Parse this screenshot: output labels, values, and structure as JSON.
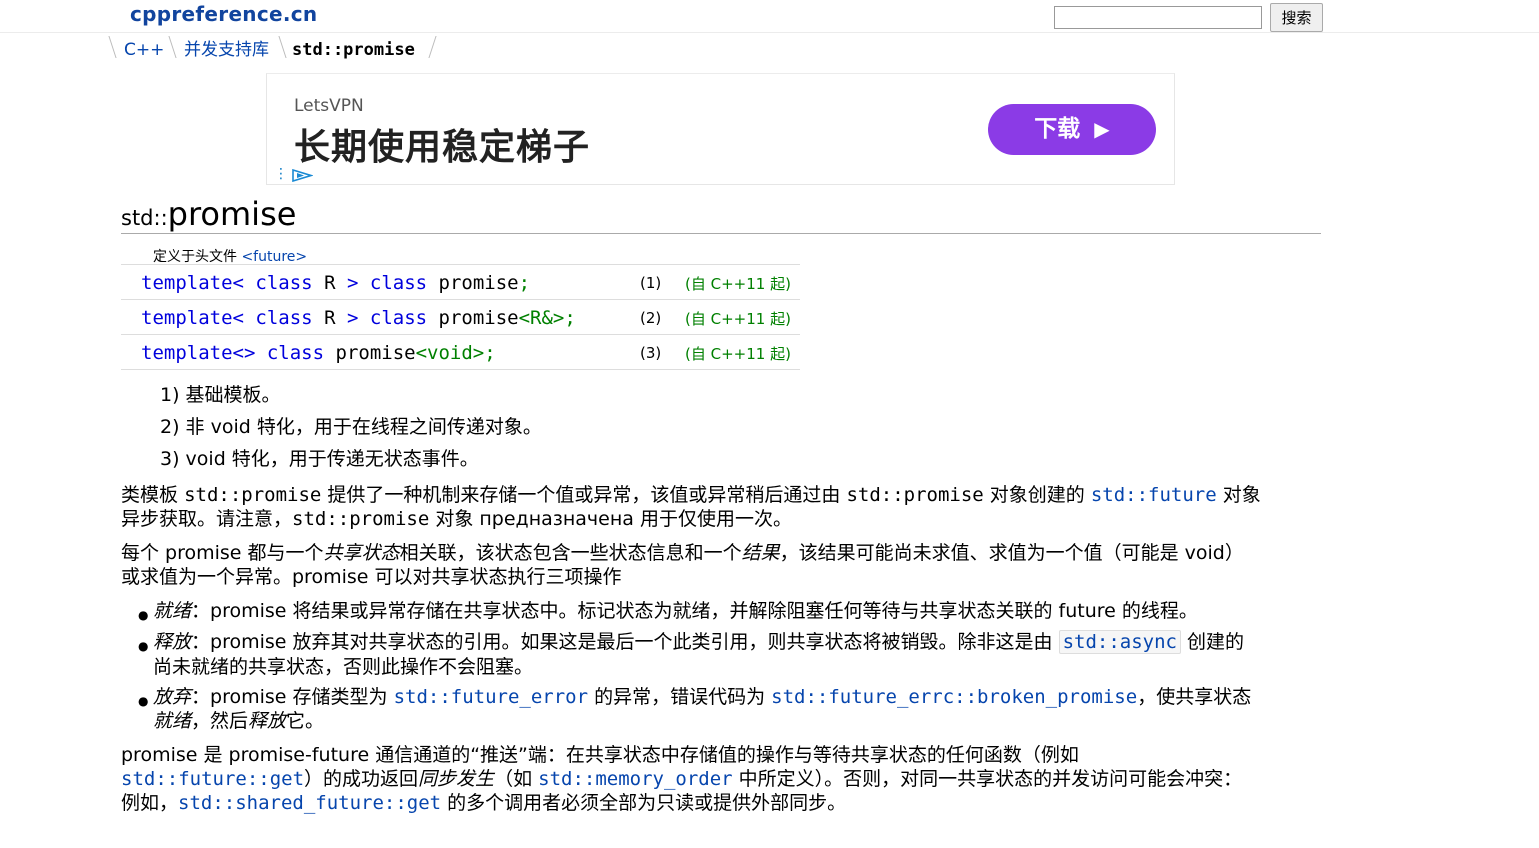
{
  "header": {
    "site_name": "cppreference.cn",
    "search_button": "搜索",
    "search_value": ""
  },
  "breadcrumb": [
    "C++",
    "并发支持库",
    "std::promise"
  ],
  "ad": {
    "brand": "LetsVPN",
    "headline": "长期使用稳定梯子",
    "button_label": "下载",
    "icons": [
      "more-vert-icon",
      "adchoices-icon",
      "chevron-right-icon"
    ]
  },
  "title": {
    "namespace": "std::",
    "name": "promise"
  },
  "declarations": {
    "header_label": "定义于头文件",
    "header_file": "<future>",
    "rows": [
      {
        "kw1": "template<",
        "kw2": "class",
        "mid": "R",
        "kw3": "class",
        "name": "promise",
        "tail": ";",
        "num": "(1)",
        "since": "(自 C++11 起)"
      },
      {
        "kw1": "template<",
        "kw2": "class",
        "mid": "R",
        "kw3": "class",
        "name": "promise",
        "tail": "<R&>;",
        "num": "(2)",
        "since": "(自 C++11 起)"
      },
      {
        "kw1": "template<>",
        "kw3": "class",
        "name": "promise",
        "tail": "<void>;",
        "num": "(3)",
        "since": "(自 C++11 起)"
      }
    ]
  },
  "notes": [
    "1) 基础模板。",
    "2) 非 void 特化，用于在线程之间传递对象。",
    "3) void 特化，用于传递无状态事件。"
  ],
  "para1": {
    "a": "类模板",
    "code1": "std::promise",
    "b": "提供了一种机制来存储一个值或异常，该值或异常稍后通过由",
    "code2": "std::promise",
    "c": "对象创建的",
    "link1": "std::future",
    "d": "对象",
    "e": "异步获取。请注意，",
    "code3": "std::promise",
    "f": "对象 предназначена 用于仅使用一次。"
  },
  "para2": {
    "a": "每个 promise 都与一个",
    "em1": "共享状态",
    "b": "相关联，该状态包含一些状态信息和一个",
    "em2": "结果",
    "c": "，该结果可能尚未求值、求值为一个值（可能是 void）",
    "line2": "或求值为一个异常。promise 可以对共享状态执行三项操作"
  },
  "bullets": {
    "b1": {
      "em": "就绪",
      "text": "：promise 将结果或异常存储在共享状态中。标记状态为就绪，并解除阻塞任何等待与共享状态关联的 future 的线程。"
    },
    "b2": {
      "em": "释放",
      "text": "：promise 放弃其对共享状态的引用。如果这是最后一个此类引用，则共享状态将被销毁。除非这是由",
      "link": "std::async",
      "text2": "创建的",
      "line2": "尚未就绪的共享状态，否则此操作不会阻塞。"
    },
    "b3": {
      "em": "放弃",
      "text": "：promise 存储类型为",
      "link1": "std::future_error",
      "text2": "的异常，错误代码为",
      "link2": "std::future_errc::broken_promise",
      "text3": "，使共享状态",
      "em2": "就绪",
      "text4": "，然后",
      "em3": "释放",
      "text5": "它。"
    }
  },
  "para3": {
    "line1": "promise 是 promise-future 通信通道的“推送”端：在共享状态中存储值的操作与等待共享状态的任何函数（例如",
    "link1": "std::future::get",
    "b": "）的成功返回",
    "em1": "同步发生",
    "c": "（如",
    "link2": "std::memory_order",
    "d": "中所定义）。否则，对同一共享状态的并发访问可能会冲突：",
    "e": "例如，",
    "link3": "std::shared_future::get",
    "f": "的多个调用者必须全部为只读或提供外部同步。"
  }
}
